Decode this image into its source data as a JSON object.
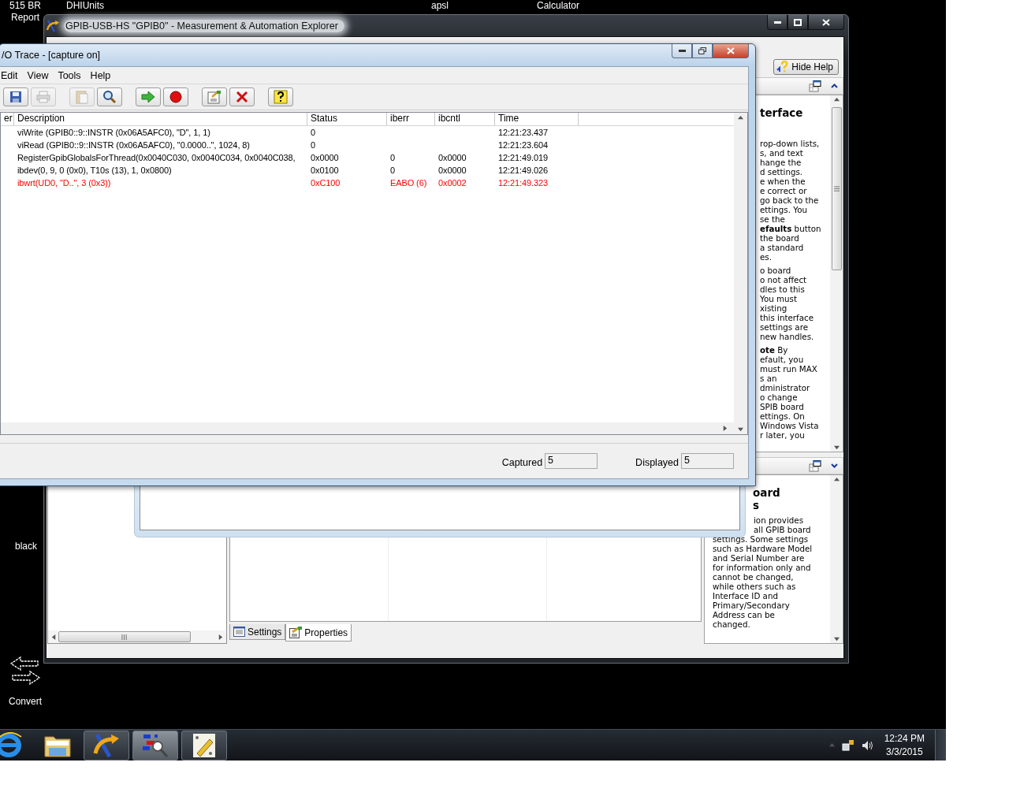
{
  "desktop_icons": [
    {
      "label": "515 BR Report",
      "kind": "plain"
    },
    {
      "label": "DHIUnits",
      "kind": "plain"
    },
    {
      "label": "apsl",
      "kind": "plain"
    },
    {
      "label": "Calculator",
      "kind": "plain"
    },
    {
      "label": "black",
      "kind": "plain"
    },
    {
      "label": "Convert",
      "kind": "convert"
    }
  ],
  "max_window": {
    "title": "GPIB-USB-HS \"GPIB0\" - Measurement & Automation Explorer",
    "hide_help": "Hide Help",
    "help_top": {
      "heading": "terface",
      "paragraphs": [
        [
          "rop-down lists,",
          "s, and text",
          "hange the",
          "d settings.",
          "e when the",
          "e correct or",
          "go back to the",
          "ettings. You",
          "se the",
          "**efaults** button",
          "the board",
          "a standard",
          "es."
        ],
        [
          "o board",
          "o not affect",
          "dles to this",
          "You must",
          "xisting",
          "this interface",
          "settings are",
          "new handles."
        ],
        [
          "**ote**  By",
          "efault, you",
          "must run MAX",
          "s an",
          "dministrator",
          "o change",
          "SPIB board",
          "ettings. On",
          "Windows Vista",
          "r later, you"
        ]
      ]
    },
    "help_bottom": {
      "heading": [
        "oard",
        "s"
      ],
      "covered_lines": [
        "ion provides",
        "all GPIB board"
      ],
      "lines": [
        "settings. Some settings",
        "such as Hardware Model",
        "and Serial Number are",
        "for information only and",
        "cannot be changed,",
        "while others such as",
        "Interface ID and",
        "Primary/Secondary",
        "Address can be",
        "changed."
      ]
    },
    "tabs": [
      {
        "label": "Settings",
        "kind": "settings",
        "selected": false
      },
      {
        "label": "Properties",
        "kind": "properties",
        "selected": true
      }
    ]
  },
  "trace_window": {
    "title": "/O Trace - [capture on]",
    "menu": [
      "Edit",
      "View",
      "Tools",
      "Help"
    ],
    "toolbar": [
      [
        {
          "kind": "save",
          "disabled": false
        },
        {
          "kind": "print",
          "disabled": true
        }
      ],
      [
        {
          "kind": "paste",
          "disabled": true
        },
        {
          "kind": "find",
          "disabled": false
        }
      ],
      [
        {
          "kind": "start",
          "disabled": false
        },
        {
          "kind": "stop",
          "disabled": false
        }
      ],
      [
        {
          "kind": "export",
          "disabled": false
        },
        {
          "kind": "clear",
          "disabled": false
        }
      ],
      [
        {
          "kind": "help",
          "disabled": false
        }
      ]
    ],
    "columns": [
      "er",
      "Description",
      "Status",
      "iberr",
      "ibcntl",
      "Time"
    ],
    "rows": [
      {
        "description": "viWrite (GPIB0::9::INSTR (0x06A5AFC0), \"D\", 1, 1)",
        "status": "0",
        "time": "12:21:23.437",
        "error": false
      },
      {
        "description": "viRead (GPIB0::9::INSTR (0x06A5AFC0), \"0.0000..\", 1024, 8)",
        "status": "0",
        "time": "12:21:23.604",
        "error": false
      },
      {
        "description": "RegisterGpibGlobalsForThread(0x0040C030, 0x0040C034, 0x0040C038,",
        "status": "0x0000",
        "iberr": "0",
        "ibcntl": "0x0000",
        "time": "12:21:49.019",
        "error": false
      },
      {
        "description": "ibdev(0, 9, 0 (0x0), T10s (13), 1, 0x0800)",
        "status": "0x0100",
        "iberr": "0",
        "ibcntl": "0x0000",
        "time": "12:21:49.026",
        "error": false
      },
      {
        "description": "ibwrt(UD0, \"D..\", 3 (0x3))",
        "status": "0xC100",
        "iberr": "EABO (6)",
        "ibcntl": "0x0002",
        "time": "12:21:49.323",
        "error": true
      }
    ],
    "captured_label": "Captured",
    "captured": "5",
    "displayed_label": "Displayed",
    "displayed": "5"
  },
  "taskbar": {
    "items": [
      {
        "kind": "browser",
        "running": false,
        "selected": false
      },
      {
        "kind": "folder",
        "running": false,
        "selected": false
      },
      {
        "kind": "max",
        "running": true,
        "selected": false
      },
      {
        "kind": "trace",
        "running": true,
        "selected": true
      },
      {
        "kind": "tool",
        "running": true,
        "selected": false
      }
    ],
    "time": "12:24 PM",
    "date": "3/3/2015"
  }
}
